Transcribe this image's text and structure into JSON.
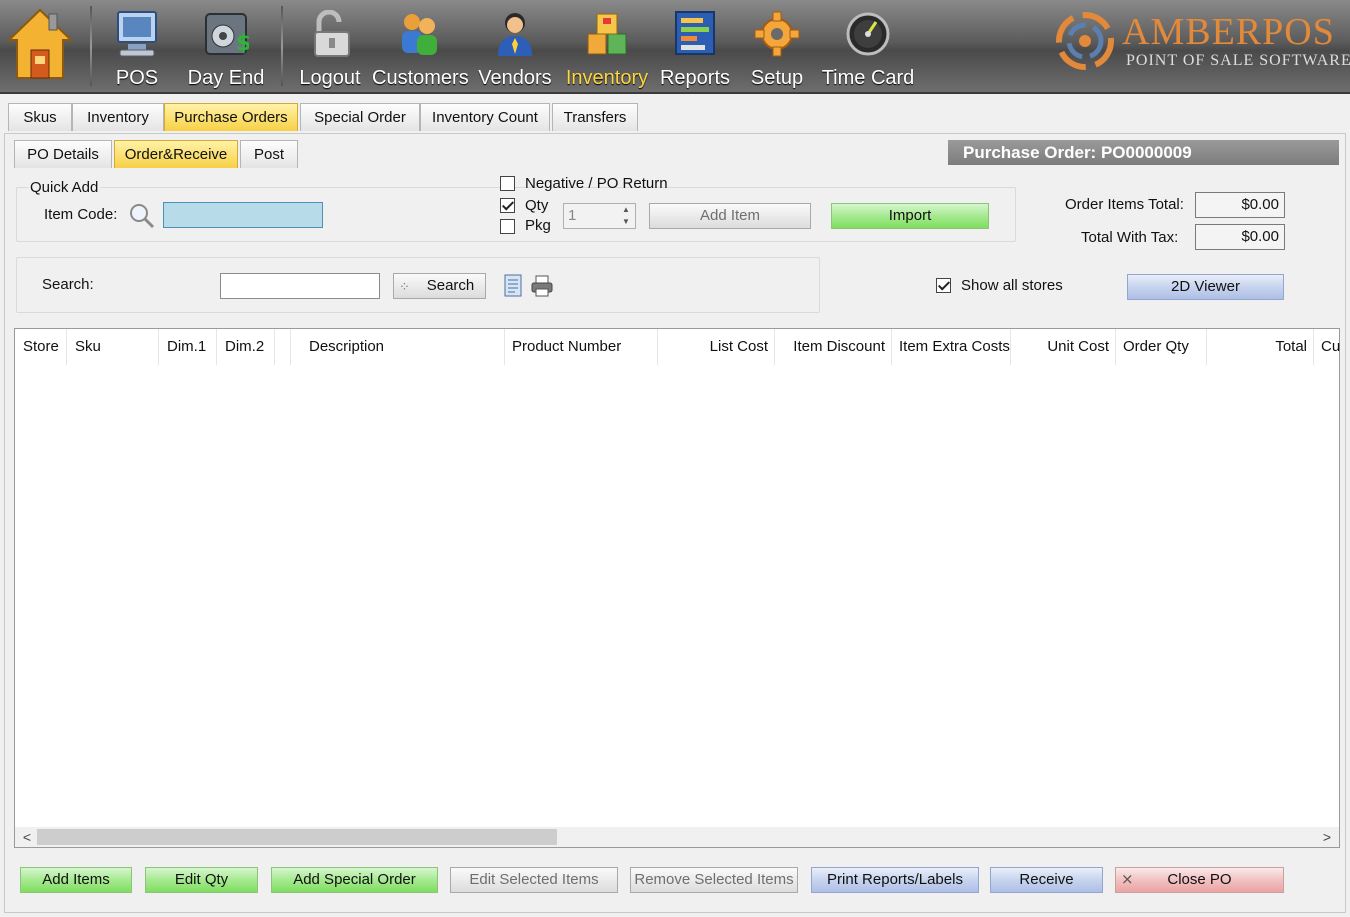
{
  "toolbar": {
    "items": [
      {
        "label": "POS",
        "icon": "pos-terminal-icon"
      },
      {
        "label": "Day End",
        "icon": "safe-money-icon"
      },
      {
        "label": "Logout",
        "icon": "padlock-icon"
      },
      {
        "label": "Customers",
        "icon": "customers-icon"
      },
      {
        "label": "Vendors",
        "icon": "vendor-person-icon"
      },
      {
        "label": "Inventory",
        "icon": "boxes-icon",
        "active": true
      },
      {
        "label": "Reports",
        "icon": "reports-chart-icon"
      },
      {
        "label": "Setup",
        "icon": "gear-icon"
      },
      {
        "label": "Time Card",
        "icon": "clock-gauge-icon"
      }
    ]
  },
  "logo": {
    "title": "AMBERPOS",
    "subtitle": "POINT OF SALE SOFTWARE"
  },
  "main_tabs": [
    "Skus",
    "Inventory",
    "Purchase Orders",
    "Special Order",
    "Inventory Count",
    "Transfers"
  ],
  "sub_tabs": [
    "PO Details",
    "Order&Receive",
    "Post"
  ],
  "po_header": "Purchase Order:  PO0000009",
  "quick_add": {
    "label": "Quick Add",
    "item_code_label": "Item Code:",
    "item_code_value": "",
    "negative_label": "Negative / PO Return",
    "negative_checked": false,
    "qty_label": "Qty",
    "qty_checked": true,
    "pkg_label": "Pkg",
    "pkg_checked": false,
    "qty_value": "1",
    "add_item": "Add Item",
    "import": "Import"
  },
  "totals": {
    "order_items_label": "Order Items Total:",
    "order_items_value": "$0.00",
    "with_tax_label": "Total With Tax:",
    "with_tax_value": "$0.00"
  },
  "search": {
    "label": "Search:",
    "value": "",
    "button": "Search"
  },
  "show_all_stores": {
    "label": "Show all stores",
    "checked": true
  },
  "viewer_button": "2D Viewer",
  "grid": {
    "columns": [
      "Store",
      "Sku",
      "Dim.1",
      "Dim.2",
      "",
      "Description",
      "Product Number",
      "List Cost",
      "Item Discount",
      "Item Extra Costs",
      "Unit Cost",
      "Order Qty",
      "Total",
      "Cu"
    ]
  },
  "bottom_buttons": [
    "Add Items",
    "Edit Qty",
    "Add Special Order",
    "Edit Selected Items",
    "Remove Selected Items",
    "Print Reports/Labels",
    "Receive",
    "Close PO"
  ],
  "colors": {
    "active_tab": "#f7d045",
    "active_nav": "#ffd640",
    "brand_orange": "#e3893a",
    "green_button": "#7fdd60",
    "blue_button": "#aebfe6",
    "red_button": "#eca3a3"
  }
}
